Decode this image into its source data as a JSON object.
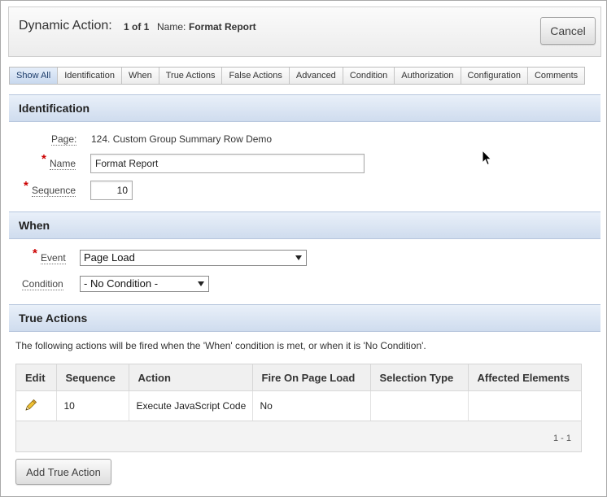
{
  "header": {
    "title": "Dynamic Action:",
    "count": "1 of 1",
    "name_label": "Name:",
    "name_value": "Format Report",
    "cancel_label": "Cancel"
  },
  "tabs": [
    {
      "label": "Show All",
      "active": true
    },
    {
      "label": "Identification"
    },
    {
      "label": "When"
    },
    {
      "label": "True Actions"
    },
    {
      "label": "False Actions"
    },
    {
      "label": "Advanced"
    },
    {
      "label": "Condition"
    },
    {
      "label": "Authorization"
    },
    {
      "label": "Configuration"
    },
    {
      "label": "Comments"
    }
  ],
  "identification": {
    "heading": "Identification",
    "page_label": "Page:",
    "page_value": "124. Custom Group Summary Row Demo",
    "name_label": "Name",
    "name_value": "Format Report",
    "sequence_label": "Sequence",
    "sequence_value": "10",
    "required_marker": "*"
  },
  "when": {
    "heading": "When",
    "event_label": "Event",
    "event_value": "Page Load",
    "condition_label": "Condition",
    "condition_value": "- No Condition -"
  },
  "true_actions": {
    "heading": "True Actions",
    "description": "The following actions will be fired when the 'When' condition is met, or when it is 'No Condition'.",
    "columns": [
      "Edit",
      "Sequence",
      "Action",
      "Fire On Page Load",
      "Selection Type",
      "Affected Elements"
    ],
    "rows": [
      {
        "sequence": "10",
        "action": "Execute JavaScript Code",
        "fire_on_page_load": "No",
        "selection_type": "",
        "affected_elements": ""
      }
    ],
    "pagination": "1 - 1",
    "add_button_label": "Add True Action"
  },
  "colors": {
    "section_bar": "#cfdcee",
    "active_tab": "#c8d8ee",
    "required": "#cc0000"
  },
  "icons": {
    "edit": "pencil-icon",
    "cursor": "mouse-pointer-icon"
  }
}
